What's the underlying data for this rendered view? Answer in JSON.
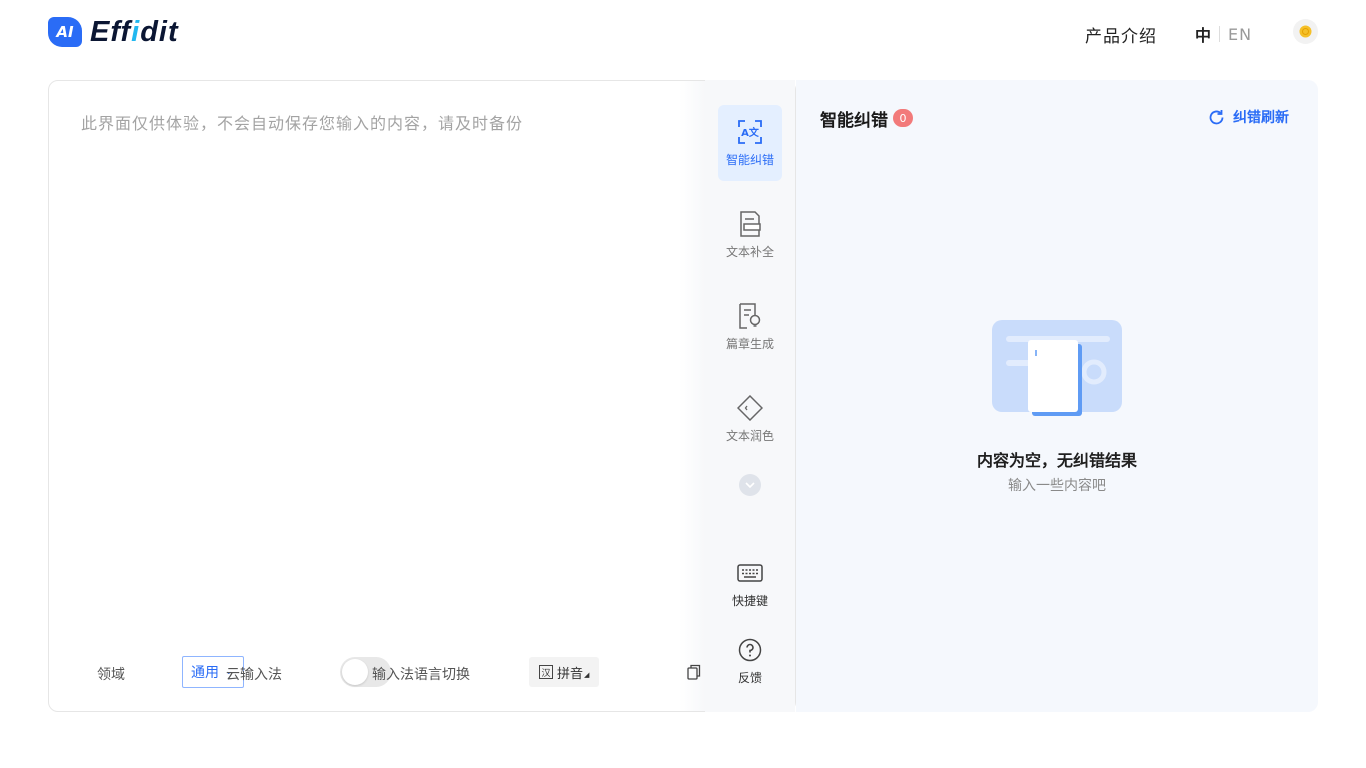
{
  "header": {
    "logo_badge": "AI",
    "logo_text_a": "Eff",
    "logo_text_i": "i",
    "logo_text_b": "dit",
    "nav_intro": "产品介绍",
    "lang_zh": "中",
    "lang_en": "EN",
    "accent": "#2a6cf6"
  },
  "editor": {
    "placeholder": "此界面仅供体验，不会自动保存您输入的内容，请及时备份"
  },
  "bottom_bar": {
    "domain_label": "领域",
    "domain_value": "通用",
    "cloud_ime_label": "云输入法",
    "cloud_ime_on": false,
    "ime_switch_label": "输入法语言切换",
    "ime_box": "汉",
    "ime_value": "拼音"
  },
  "toolbar": {
    "items": [
      {
        "label": "智能纠错",
        "icon": "scan-text-icon",
        "active": true
      },
      {
        "label": "文本补全",
        "icon": "document-complete-icon",
        "active": false
      },
      {
        "label": "篇章生成",
        "icon": "document-bulb-icon",
        "active": false
      },
      {
        "label": "文本润色",
        "icon": "tag-icon",
        "active": false
      }
    ],
    "shortcuts_label": "快捷键",
    "feedback_label": "反馈"
  },
  "panel": {
    "title": "智能纠错",
    "count": "0",
    "refresh_label": "纠错刷新",
    "empty_title": "内容为空，无纠错结果",
    "empty_sub": "输入一些内容吧",
    "badge_color": "#f27a7a"
  }
}
